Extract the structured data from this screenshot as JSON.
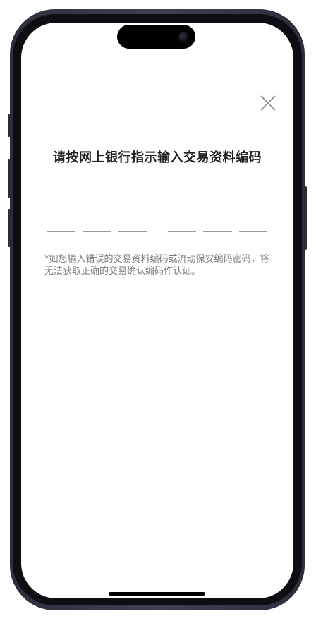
{
  "dialog": {
    "close_icon": "close-icon",
    "title": "请按网上银行指示输入交易资料编码",
    "code_fields": [
      {
        "value": ""
      },
      {
        "value": ""
      },
      {
        "value": ""
      },
      {
        "value": ""
      },
      {
        "value": ""
      },
      {
        "value": ""
      }
    ],
    "note": "*如您输入错误的交易资料编码或流动保安编码密码，将无法获取正确的交易确认编码作认证。"
  },
  "colors": {
    "background": "#ffffff",
    "title_text": "#222222",
    "note_text": "#7a7a7a",
    "field_underline": "#9b9b9b",
    "phone_frame": "#2c2f3b"
  }
}
